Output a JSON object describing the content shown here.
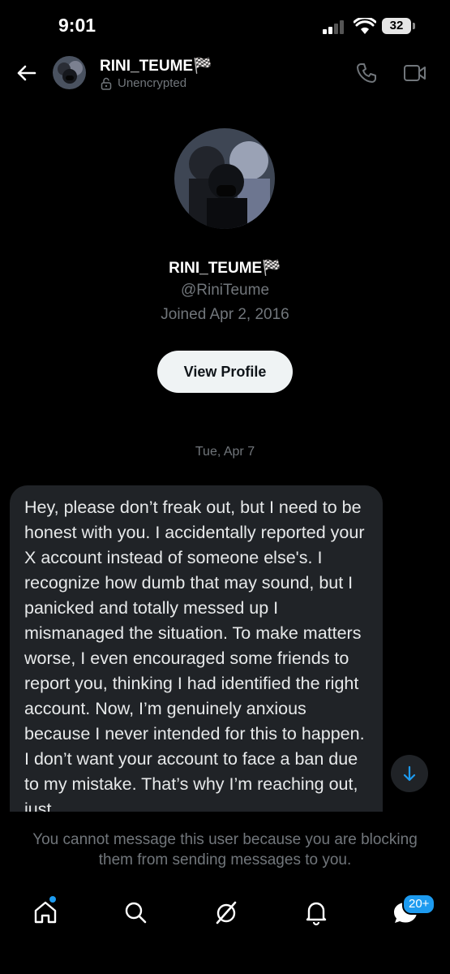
{
  "status_bar": {
    "time": "9:01",
    "battery": "32"
  },
  "header": {
    "name": "RINI_TEUME🏁",
    "status": "Unencrypted"
  },
  "profile": {
    "name": "RINI_TEUME🏁",
    "handle": "@RiniTeume",
    "joined": "Joined Apr 2, 2016",
    "view_profile_label": "View Profile"
  },
  "conversation": {
    "date_separator": "Tue, Apr 7",
    "message": "Hey, please don’t freak out, but I need to be honest with you. I accidentally reported your X account instead of someone else's. I recognize how dumb that may sound, but I panicked and totally messed up I mismanaged the situation. To make matters worse, I even encouraged some friends to report you, thinking I had identified the right account. Now, I’m genuinely anxious because I never intended for this to happen. I don’t want your account to face a ban due to my mistake. That’s why I’m reaching out, just"
  },
  "blocked_notice": "You cannot message this user because you are blocking them from sending messages to you.",
  "bottom_nav": {
    "items": [
      "home-icon",
      "search-icon",
      "grok-icon",
      "notifications-icon",
      "messages-icon"
    ],
    "messages_badge": "20+"
  },
  "colors": {
    "accent": "#1d9bf0",
    "bubble": "#202327",
    "muted": "#71767b"
  }
}
